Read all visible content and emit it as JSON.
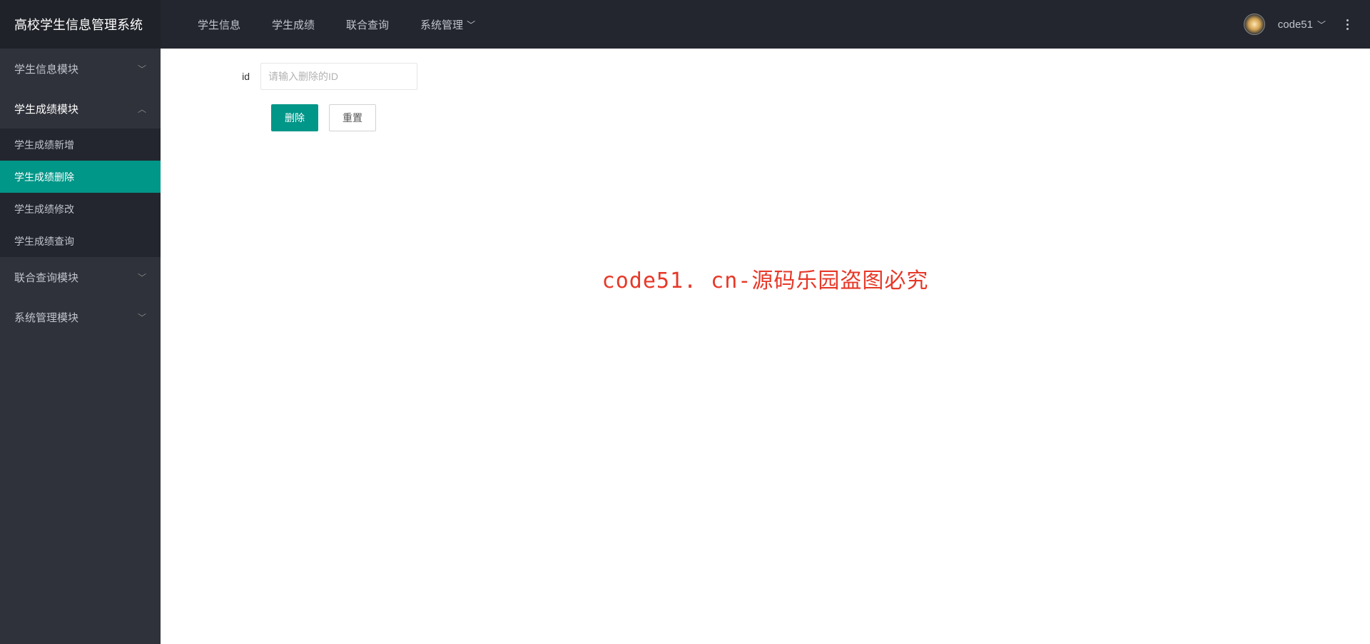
{
  "header": {
    "logo": "高校学生信息管理系统",
    "nav": {
      "item0": "学生信息",
      "item1": "学生成绩",
      "item2": "联合查询",
      "item3": "系统管理"
    },
    "username": "code51"
  },
  "sidebar": {
    "group0": {
      "label": "学生信息模块"
    },
    "group1": {
      "label": "学生成绩模块",
      "sub0": "学生成绩新增",
      "sub1": "学生成绩删除",
      "sub2": "学生成绩修改",
      "sub3": "学生成绩查询"
    },
    "group2": {
      "label": "联合查询模块"
    },
    "group3": {
      "label": "系统管理模块"
    }
  },
  "form": {
    "id_label": "id",
    "id_placeholder": "请输入删除的ID",
    "delete_btn": "删除",
    "reset_btn": "重置"
  },
  "watermark": "code51. cn-源码乐园盗图必究"
}
